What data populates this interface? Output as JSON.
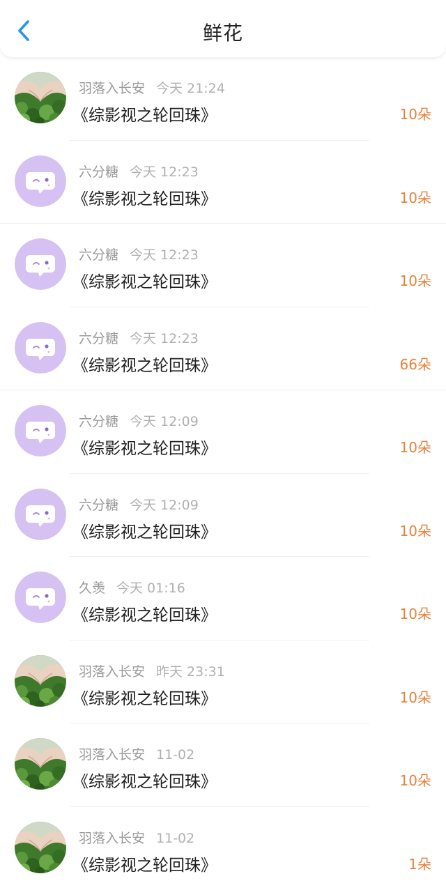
{
  "header": {
    "title": "鲜花",
    "back_icon": "chevron-left-icon",
    "accent_color": "#2196f3"
  },
  "colors": {
    "count": "#e8823a",
    "purple_avatar": "#d6c2f2"
  },
  "items": [
    {
      "avatar": "photo-hands",
      "user": "羽落入长安",
      "time": "今天 21:24",
      "book": "《综影视之轮回珠》",
      "count": "10朵"
    },
    {
      "avatar": "purple-chat",
      "user": "六分糖",
      "time": "今天 12:23",
      "book": "《综影视之轮回珠》",
      "count": "10朵"
    },
    {
      "avatar": "purple-chat",
      "user": "六分糖",
      "time": "今天 12:23",
      "book": "《综影视之轮回珠》",
      "count": "10朵"
    },
    {
      "avatar": "purple-chat",
      "user": "六分糖",
      "time": "今天 12:23",
      "book": "《综影视之轮回珠》",
      "count": "66朵"
    },
    {
      "avatar": "purple-chat",
      "user": "六分糖",
      "time": "今天 12:09",
      "book": "《综影视之轮回珠》",
      "count": "10朵"
    },
    {
      "avatar": "purple-chat",
      "user": "六分糖",
      "time": "今天 12:09",
      "book": "《综影视之轮回珠》",
      "count": "10朵"
    },
    {
      "avatar": "purple-chat",
      "user": "久羡",
      "time": "今天 01:16",
      "book": "《综影视之轮回珠》",
      "count": "10朵"
    },
    {
      "avatar": "photo-hands",
      "user": "羽落入长安",
      "time": "昨天 23:31",
      "book": "《综影视之轮回珠》",
      "count": "10朵"
    },
    {
      "avatar": "photo-hands",
      "user": "羽落入长安",
      "time": "11-02",
      "book": "《综影视之轮回珠》",
      "count": "10朵"
    },
    {
      "avatar": "photo-hands",
      "user": "羽落入长安",
      "time": "11-02",
      "book": "《综影视之轮回珠》",
      "count": "1朵"
    }
  ]
}
